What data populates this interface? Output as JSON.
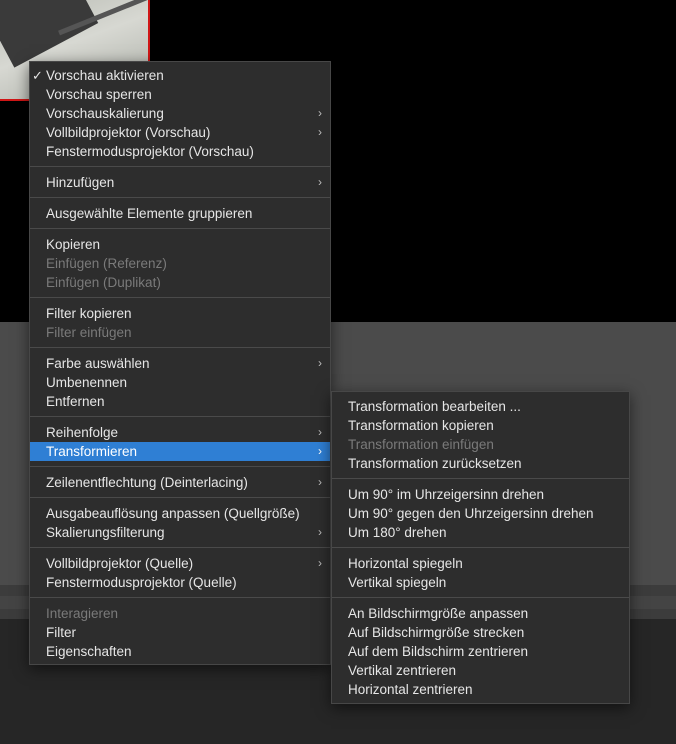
{
  "main_menu": {
    "items": [
      {
        "label": "Vorschau aktivieren",
        "checked": true
      },
      {
        "label": "Vorschau sperren"
      },
      {
        "label": "Vorschauskalierung",
        "submenu": true
      },
      {
        "label": "Vollbildprojektor (Vorschau)",
        "submenu": true
      },
      {
        "label": "Fenstermodusprojektor (Vorschau)"
      },
      {
        "label": "Hinzufügen",
        "submenu": true
      },
      {
        "label": "Ausgewählte Elemente gruppieren"
      },
      {
        "label": "Kopieren"
      },
      {
        "label": "Einfügen (Referenz)",
        "disabled": true
      },
      {
        "label": "Einfügen (Duplikat)",
        "disabled": true
      },
      {
        "label": "Filter kopieren"
      },
      {
        "label": "Filter einfügen",
        "disabled": true
      },
      {
        "label": "Farbe auswählen",
        "submenu": true
      },
      {
        "label": "Umbenennen"
      },
      {
        "label": "Entfernen"
      },
      {
        "label": "Reihenfolge",
        "submenu": true
      },
      {
        "label": "Transformieren",
        "submenu": true,
        "selected": true
      },
      {
        "label": "Zeilenentflechtung (Deinterlacing)",
        "submenu": true
      },
      {
        "label": "Ausgabeauflösung anpassen (Quellgröße)"
      },
      {
        "label": "Skalierungsfilterung",
        "submenu": true
      },
      {
        "label": "Vollbildprojektor (Quelle)",
        "submenu": true
      },
      {
        "label": "Fenstermodusprojektor (Quelle)"
      },
      {
        "label": "Interagieren",
        "disabled": true
      },
      {
        "label": "Filter"
      },
      {
        "label": "Eigenschaften"
      }
    ]
  },
  "transform_submenu": {
    "items": [
      {
        "label": "Transformation bearbeiten ..."
      },
      {
        "label": "Transformation kopieren"
      },
      {
        "label": "Transformation einfügen",
        "disabled": true
      },
      {
        "label": "Transformation zurücksetzen"
      },
      {
        "label": "Um 90° im Uhrzeigersinn drehen"
      },
      {
        "label": "Um 90° gegen den Uhrzeigersinn drehen"
      },
      {
        "label": "Um 180° drehen"
      },
      {
        "label": "Horizontal spiegeln"
      },
      {
        "label": "Vertikal spiegeln"
      },
      {
        "label": "An Bildschirmgröße anpassen"
      },
      {
        "label": "Auf Bildschirmgröße strecken"
      },
      {
        "label": "Auf dem Bildschirm zentrieren"
      },
      {
        "label": "Vertikal zentrieren"
      },
      {
        "label": "Horizontal zentrieren"
      }
    ]
  },
  "glyphs": {
    "check": "✓",
    "chevron": "›"
  },
  "colors": {
    "highlight": "#2f7fd4",
    "menu_bg": "#2d2d2d",
    "preview_border": "#d01616"
  }
}
